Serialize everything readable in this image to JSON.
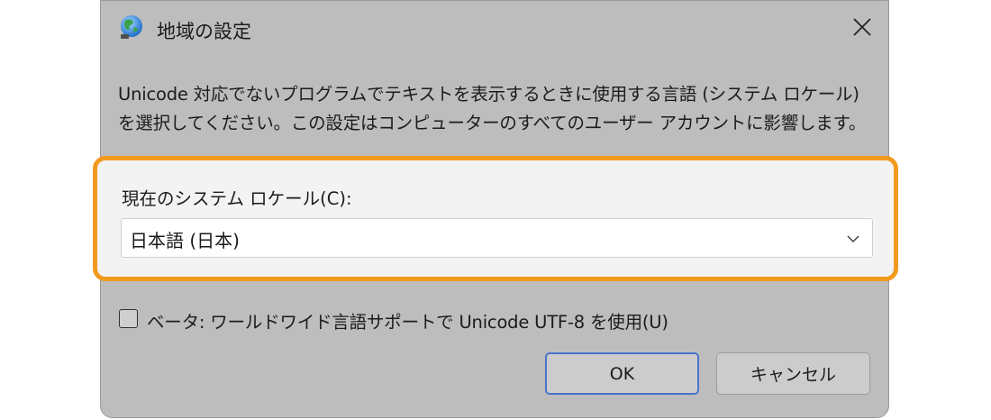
{
  "dialog": {
    "title": "地域の設定",
    "description": "Unicode 対応でないプログラムでテキストを表示するときに使用する言語 (システム ロケール) を選択してください。この設定はコンピューターのすべてのユーザー アカウントに影響します。",
    "icons": {
      "app": "globe-icon",
      "close": "close-icon",
      "dropdown": "chevron-down-icon"
    }
  },
  "locale": {
    "label": "現在のシステム ロケール(C):",
    "selected": "日本語 (日本)"
  },
  "beta": {
    "label": "ベータ: ワールドワイド言語サポートで Unicode UTF-8 を使用(U)",
    "checked": false
  },
  "buttons": {
    "ok": "OK",
    "cancel": "キャンセル"
  },
  "colors": {
    "highlight": "#f29a1f",
    "dialog_bg": "#bdbdbd",
    "panel_bg": "#f3f3f3",
    "ok_border": "#4a74c9"
  }
}
